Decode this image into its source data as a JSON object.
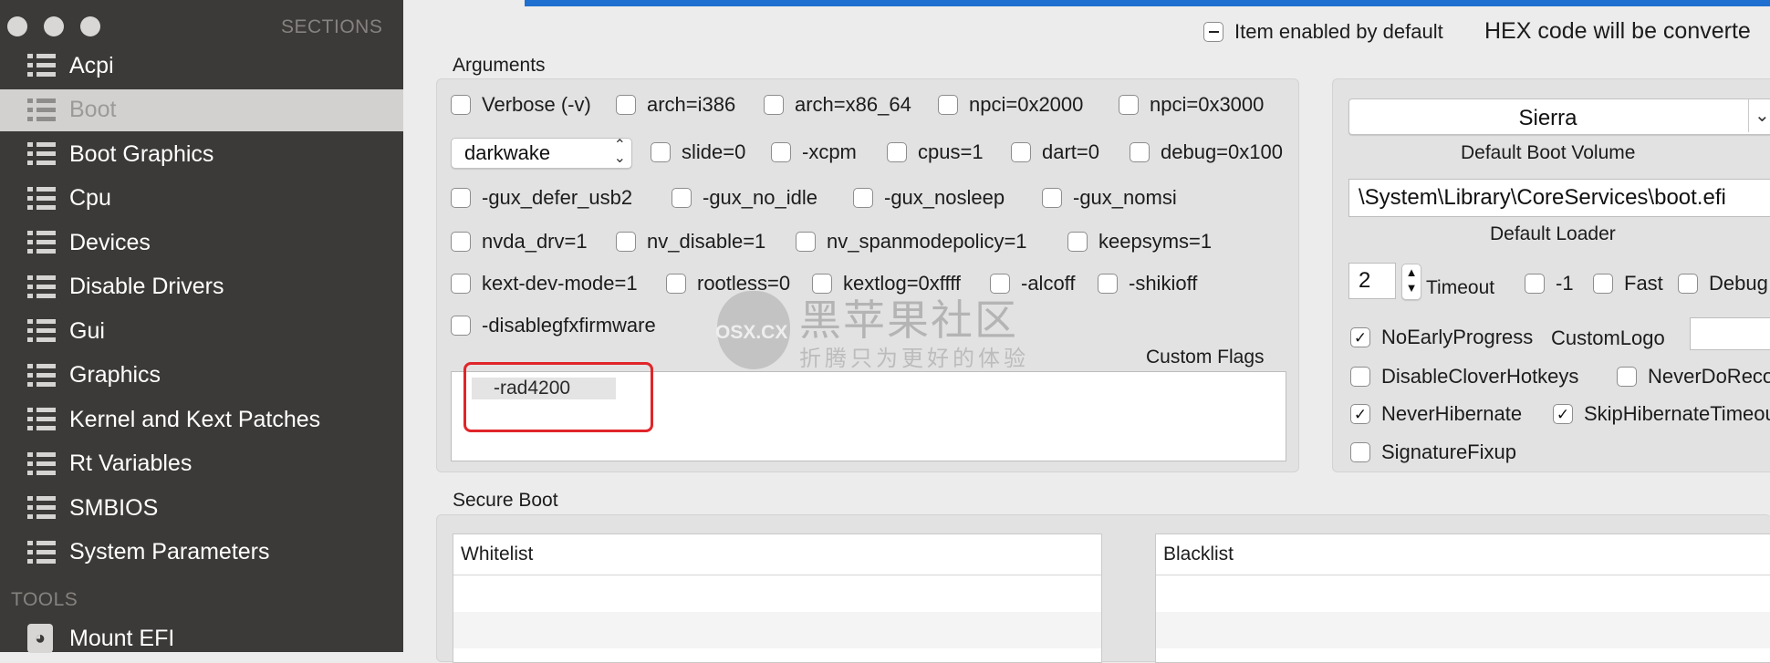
{
  "sidebar": {
    "sections_header": "SECTIONS",
    "tools_header": "TOOLS",
    "selected": "Boot",
    "items": [
      {
        "label": "Acpi"
      },
      {
        "label": "Boot"
      },
      {
        "label": "Boot Graphics"
      },
      {
        "label": "Cpu"
      },
      {
        "label": "Devices"
      },
      {
        "label": "Disable Drivers"
      },
      {
        "label": "Gui"
      },
      {
        "label": "Graphics"
      },
      {
        "label": "Kernel and Kext Patches"
      },
      {
        "label": "Rt Variables"
      },
      {
        "label": "SMBIOS"
      },
      {
        "label": "System Parameters"
      }
    ],
    "tools": [
      {
        "label": "Mount EFI",
        "icon": "disk-icon"
      }
    ]
  },
  "top": {
    "item_enabled_label": "Item enabled by default",
    "hex_note": "HEX code will be converte"
  },
  "arguments": {
    "title": "Arguments",
    "row1": [
      "Verbose (-v)",
      "arch=i386",
      "arch=x86_64",
      "npci=0x2000",
      "npci=0x3000"
    ],
    "darkwake_value": "darkwake",
    "row2": [
      "slide=0",
      "-xcpm",
      "cpus=1",
      "dart=0",
      "debug=0x100"
    ],
    "row3": [
      "-gux_defer_usb2",
      "-gux_no_idle",
      "-gux_nosleep",
      "-gux_nomsi"
    ],
    "row4": [
      "nvda_drv=1",
      "nv_disable=1",
      "nv_spanmodepolicy=1",
      "keepsyms=1"
    ],
    "row5": [
      "kext-dev-mode=1",
      "rootless=0",
      "kextlog=0xffff",
      "-alcoff",
      "-shikioff"
    ],
    "row6": [
      "-disablegfxfirmware"
    ],
    "custom_flags_label": "Custom Flags",
    "custom_flags_value": "-rad4200"
  },
  "boot_volume": {
    "volume_value": "Sierra",
    "volume_label": "Default Boot Volume",
    "loader_value": "\\System\\Library\\CoreServices\\boot.efi",
    "loader_label": "Default Loader",
    "timeout_value": "2",
    "timeout_label": "Timeout",
    "timeout_opts": [
      "-1",
      "Fast",
      "Debug"
    ],
    "no_early_progress": "NoEarlyProgress",
    "custom_logo_label": "CustomLogo",
    "disable_clover_hotkeys": "DisableCloverHotkeys",
    "never_do_recovery": "NeverDoRecovery",
    "never_hibernate": "NeverHibernate",
    "skip_hibernate_timeout": "SkipHibernateTimeout",
    "signature_fixup": "SignatureFixup"
  },
  "secure_boot": {
    "title": "Secure Boot",
    "whitelist_header": "Whitelist",
    "blacklist_header": "Blacklist"
  },
  "watermark": {
    "brand": "OSX.CX",
    "title": "黑苹果社区",
    "subtitle": "折腾只为更好的体验"
  },
  "colors": {
    "sidebar_bg": "#3c3a38",
    "selected_row": "#d2d1cf",
    "accent_blue": "#1f6fd0",
    "highlight_red": "#e0252a"
  }
}
